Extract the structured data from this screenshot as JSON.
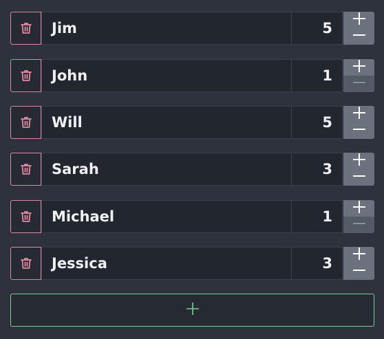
{
  "players": [
    {
      "name": "Jim",
      "count": "5",
      "minus_enabled": true
    },
    {
      "name": "John",
      "count": "1",
      "minus_enabled": false
    },
    {
      "name": "Will",
      "count": "5",
      "minus_enabled": true
    },
    {
      "name": "Sarah",
      "count": "3",
      "minus_enabled": true
    },
    {
      "name": "Michael",
      "count": "1",
      "minus_enabled": false
    },
    {
      "name": "Jessica",
      "count": "3",
      "minus_enabled": true
    }
  ],
  "icons": {
    "delete": "trash-icon",
    "increment": "plus-icon",
    "decrement": "minus-icon",
    "add_row": "plus-icon"
  },
  "colors": {
    "background": "#2d323d",
    "field": "#22262e",
    "delete_border": "#d98aa0",
    "stepper": "#6b717d",
    "stepper_disabled": "#545a66",
    "add_border": "#7fd08f"
  }
}
